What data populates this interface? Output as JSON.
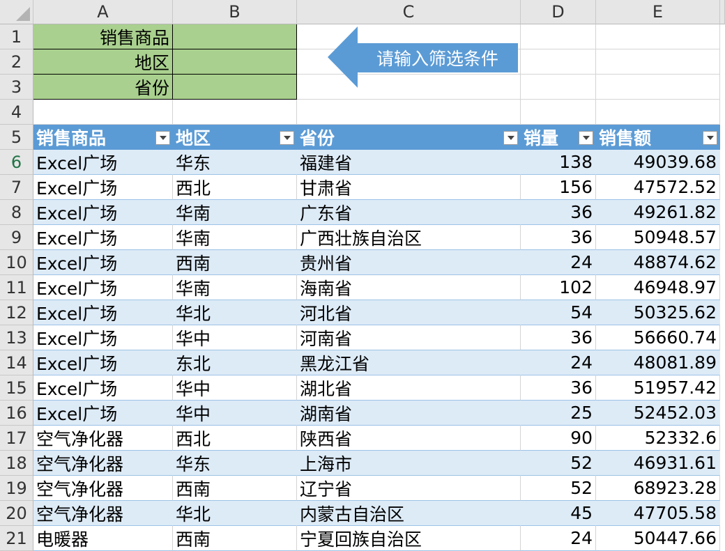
{
  "columns": [
    "A",
    "B",
    "C",
    "D",
    "E"
  ],
  "criteria": [
    {
      "row": "1",
      "label": "销售商品",
      "value": ""
    },
    {
      "row": "2",
      "label": "地区",
      "value": ""
    },
    {
      "row": "3",
      "label": "省份",
      "value": ""
    }
  ],
  "row4": "4",
  "callout": {
    "text": "请输入筛选条件"
  },
  "table": {
    "header_row": "5",
    "headers": [
      "销售商品",
      "地区",
      "省份",
      "销量",
      "销售额"
    ],
    "rows": [
      {
        "row": "6",
        "cells": [
          "Excel广场",
          "华东",
          "福建省",
          "138",
          "49039.68"
        ]
      },
      {
        "row": "7",
        "cells": [
          "Excel广场",
          "西北",
          "甘肃省",
          "156",
          "47572.52"
        ]
      },
      {
        "row": "8",
        "cells": [
          "Excel广场",
          "华南",
          "广东省",
          "36",
          "49261.82"
        ]
      },
      {
        "row": "9",
        "cells": [
          "Excel广场",
          "华南",
          "广西壮族自治区",
          "36",
          "50948.57"
        ]
      },
      {
        "row": "10",
        "cells": [
          "Excel广场",
          "西南",
          "贵州省",
          "24",
          "48874.62"
        ]
      },
      {
        "row": "11",
        "cells": [
          "Excel广场",
          "华南",
          "海南省",
          "102",
          "46948.97"
        ]
      },
      {
        "row": "12",
        "cells": [
          "Excel广场",
          "华北",
          "河北省",
          "54",
          "50325.62"
        ]
      },
      {
        "row": "13",
        "cells": [
          "Excel广场",
          "华中",
          "河南省",
          "36",
          "56660.74"
        ]
      },
      {
        "row": "14",
        "cells": [
          "Excel广场",
          "东北",
          "黑龙江省",
          "24",
          "48081.89"
        ]
      },
      {
        "row": "15",
        "cells": [
          "Excel广场",
          "华中",
          "湖北省",
          "36",
          "51957.42"
        ]
      },
      {
        "row": "16",
        "cells": [
          "Excel广场",
          "华中",
          "湖南省",
          "25",
          "52452.03"
        ]
      },
      {
        "row": "17",
        "cells": [
          "空气净化器",
          "西北",
          "陕西省",
          "90",
          "52332.6"
        ]
      },
      {
        "row": "18",
        "cells": [
          "空气净化器",
          "华东",
          "上海市",
          "52",
          "46931.61"
        ]
      },
      {
        "row": "19",
        "cells": [
          "空气净化器",
          "西南",
          "辽宁省",
          "52",
          "68923.28"
        ]
      },
      {
        "row": "20",
        "cells": [
          "空气净化器",
          "华北",
          "内蒙古自治区",
          "45",
          "47705.58"
        ]
      },
      {
        "row": "21",
        "cells": [
          "电暖器",
          "西南",
          "宁夏回族自治区",
          "24",
          "50447.66"
        ]
      }
    ]
  },
  "colors": {
    "header_blue": "#5b9bd5",
    "band_blue": "#ddebf7",
    "criteria_green": "#a9d08e",
    "arrow": "#5b9bd5"
  }
}
